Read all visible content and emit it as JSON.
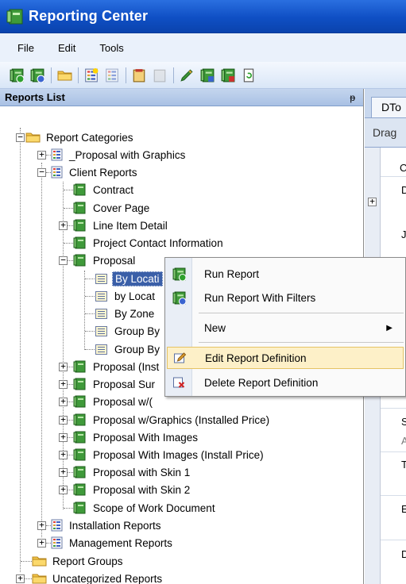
{
  "window": {
    "title": "Reporting Center"
  },
  "menu": [
    "File",
    "Edit",
    "Tools"
  ],
  "toolbar": {
    "buttons": [
      "run-report-icon",
      "run-report-filters-icon",
      "open-folder-icon",
      "new-report-icon",
      "edit-report-icon",
      "new-category-icon",
      "edit-category-icon",
      "edit-icon",
      "report-icon",
      "delete-report-icon",
      "refresh-icon"
    ]
  },
  "reports_panel": {
    "title": "Reports List",
    "pin": "ᵽ"
  },
  "tree": {
    "root": "Report Categories",
    "proposal_graphics": "_Proposal with Graphics",
    "client_reports": "Client Reports",
    "contract": "Contract",
    "cover_page": "Cover Page",
    "line_item_detail": "Line Item Detail",
    "project_contact": "Project Contact Information",
    "proposal": "Proposal",
    "by_location": "By Locati",
    "by_location2": "by Locat",
    "by_zone": "By Zone",
    "group_by1": "Group By",
    "group_by2": "Group By",
    "proposal_install": "Proposal (Inst",
    "proposal_summary": "Proposal Sur",
    "proposal_w": "Proposal w/(",
    "proposal_wgraphics": "Proposal w/Graphics (Installed Price)",
    "proposal_images": "Proposal With Images",
    "proposal_images_install": "Proposal With Images (Install Price)",
    "proposal_skin1": "Proposal with Skin 1",
    "proposal_skin2": "Proposal with Skin 2",
    "scope_of_work": "Scope of Work Document",
    "installation": "Installation Reports",
    "management": "Management Reports",
    "report_groups": "Report Groups",
    "uncategorized": "Uncategorized Reports"
  },
  "right_pane": {
    "tab": "DTo",
    "drag": "Drag",
    "cells": [
      "Cl",
      "D",
      "J",
      "S",
      "A",
      "T",
      "E",
      "D"
    ]
  },
  "context_menu": {
    "run_report": "Run Report",
    "run_with_filters": "Run Report With Filters",
    "new": "New",
    "edit_definition": "Edit Report Definition",
    "delete_definition": "Delete Report Definition"
  },
  "colors": {
    "titlebar": "#0f4fc4",
    "selection": "#3a5fa8",
    "menu_hover": "#fdf0c8",
    "report_icon": "#3f9a3a"
  }
}
